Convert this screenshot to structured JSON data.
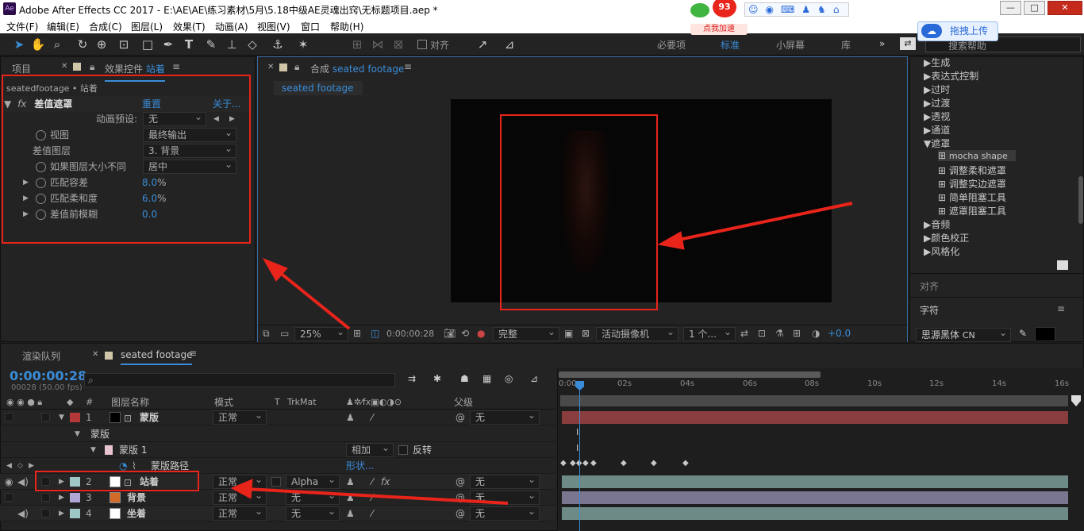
{
  "window": {
    "title": "Adobe After Effects CC 2017 - E:\\AE\\AE\\练习素材\\5月\\5.18中级AE灵魂出窍\\无标题项目.aep *",
    "app_badge": "Ae",
    "minimize": "—",
    "maximize": "□",
    "close": "✕"
  },
  "overlay": {
    "badge_count": "93",
    "badge_label": "点我加速",
    "upload_label": "拖拽上传"
  },
  "menu": [
    "文件(F)",
    "编辑(E)",
    "合成(C)",
    "图层(L)",
    "效果(T)",
    "动画(A)",
    "视图(V)",
    "窗口",
    "帮助(H)"
  ],
  "toolbar": {
    "align": "对齐",
    "workspaces": [
      "必要项",
      "标准",
      "小屏幕",
      "库"
    ],
    "search_placeholder": "搜索帮助"
  },
  "left_panel": {
    "tab_project": "项目",
    "tab_effects": "效果控件",
    "tab_layer": "站着",
    "breadcrumb": "seatedfootage • 站着",
    "effect_name": "差值遮罩",
    "reset": "重置",
    "about": "关于...",
    "rows": [
      {
        "label": "动画预设:",
        "value": "无"
      },
      {
        "label": "视图",
        "value": "最终输出"
      },
      {
        "label": "差值图层",
        "value": "3. 背景"
      },
      {
        "label": "如果图层大小不同",
        "value": "居中"
      },
      {
        "label": "匹配容差",
        "value": "8.0",
        "unit": "%"
      },
      {
        "label": "匹配柔和度",
        "value": "6.0",
        "unit": "%"
      },
      {
        "label": "差值前模糊",
        "value": "0.0"
      }
    ]
  },
  "comp_panel": {
    "tab_prefix": "合成",
    "tab_name": "seated footage",
    "sub_tab": "seated footage",
    "zoom": "25%",
    "timecode": "0:00:00:28",
    "quality": "完整",
    "camera": "活动摄像机",
    "views": "1 个...",
    "exposure": "+0.0"
  },
  "effects_list": {
    "items": [
      "生成",
      "表达式控制",
      "过时",
      "过渡",
      "透视",
      "通道",
      "遮罩"
    ],
    "sub_items": [
      "mocha shape",
      "调整柔和遮罩",
      "调整实边遮罩",
      "简单阻塞工具",
      "遮罩阻塞工具"
    ],
    "items2": [
      "音频",
      "颜色校正",
      "风格化"
    ],
    "align_title": "对齐",
    "char_title": "字符",
    "font": "思源黑体",
    "font_style": "CN"
  },
  "timeline": {
    "tab_render": "渲染队列",
    "tab_comp": "seated footage",
    "timecode": "0:00:00:28",
    "fps_info": "00028 (50.00 fps)",
    "headers": {
      "num": "#",
      "name": "图层名称",
      "mode": "模式",
      "t": "T",
      "trkmat": "TrkMat",
      "parent": "父级"
    },
    "ruler": [
      "0:00s",
      "02s",
      "04s",
      "06s",
      "08s",
      "10s",
      "12s",
      "14s",
      "16s"
    ],
    "layers": [
      {
        "num": "1",
        "name": "蒙版",
        "mode": "正常",
        "trkmat": "",
        "parent": "无",
        "color": "#b53838"
      },
      {
        "num": "2",
        "name": "站着",
        "mode": "正常",
        "trkmat": "Alpha",
        "parent": "无",
        "color": "#9fc7c5"
      },
      {
        "num": "3",
        "name": "背景",
        "mode": "正常",
        "trkmat": "无",
        "parent": "无",
        "color": "#b2a6d4"
      },
      {
        "num": "4",
        "name": "坐着",
        "mode": "正常",
        "trkmat": "无",
        "parent": "无",
        "color": "#9fc7c5"
      }
    ],
    "mask_group": "蒙版",
    "mask_name": "蒙版 1",
    "mask_mode": "相加",
    "invert": "反转",
    "mask_path": "蒙版路径",
    "shape": "形状..."
  }
}
